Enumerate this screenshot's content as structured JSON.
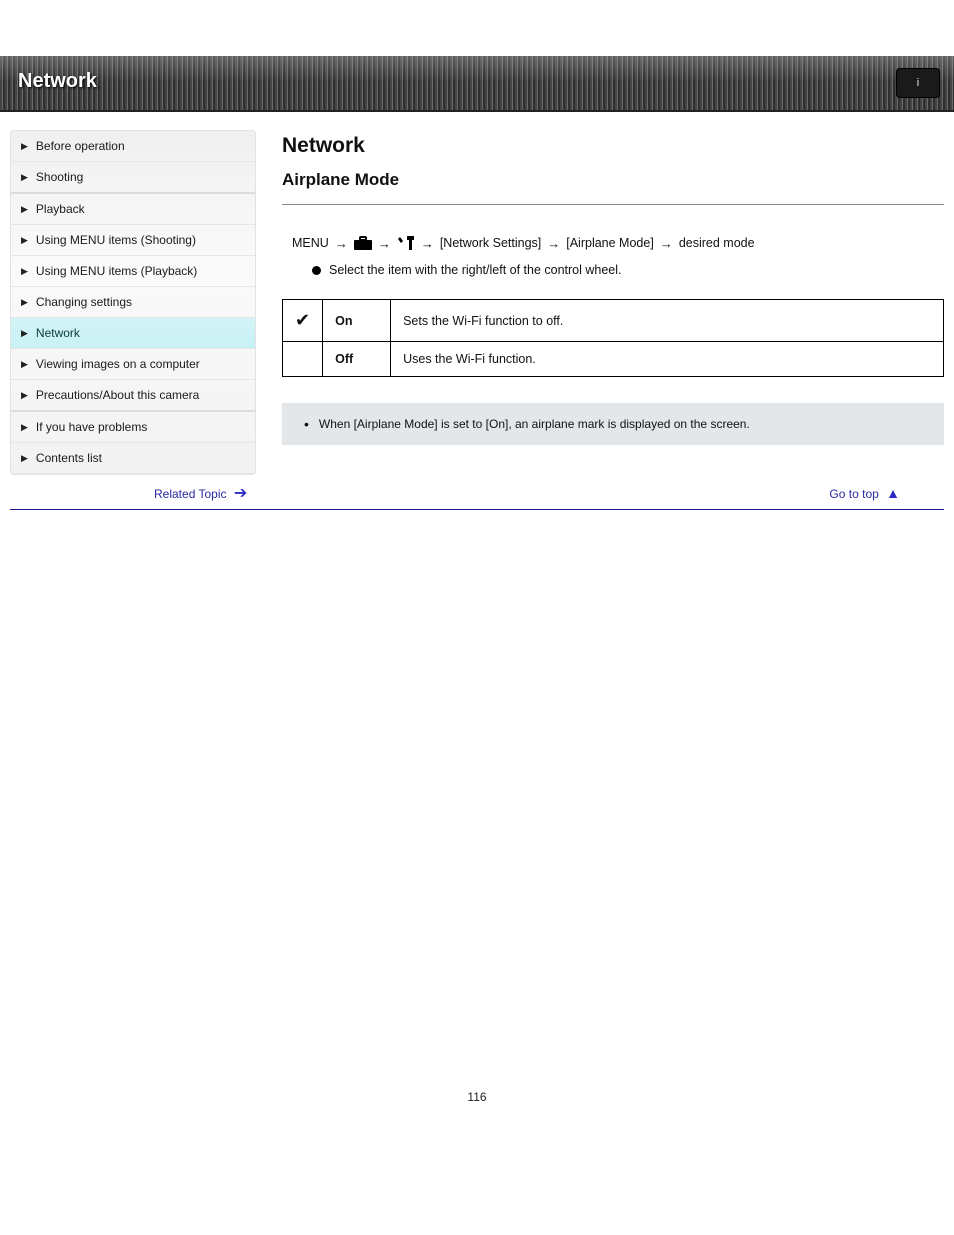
{
  "banner": {
    "title": "Network",
    "button_label": "i"
  },
  "sidebar": {
    "items": [
      {
        "label": "Before operation"
      },
      {
        "label": "Shooting"
      },
      {
        "label": "Playback"
      },
      {
        "label": "Using MENU items (Shooting)"
      },
      {
        "label": "Using MENU items (Playback)"
      },
      {
        "label": "Changing settings"
      },
      {
        "label": "Network"
      },
      {
        "label": "Viewing images on a computer"
      },
      {
        "label": "Precautions/About this camera"
      },
      {
        "label": "If you have problems"
      },
      {
        "label": "Contents list"
      }
    ]
  },
  "content": {
    "heading1": "Network",
    "heading2": "Airplane Mode",
    "navpath": {
      "step_menu": "MENU",
      "step_toolbox": "",
      "step_tools": "",
      "step_network": "[Network Settings]",
      "step_airplane": "[Airplane Mode]",
      "step_desired": "desired mode"
    },
    "substep": "Select the item with the right/left of the control wheel.",
    "table": [
      {
        "icon": "check",
        "option": "On",
        "desc": "Sets the Wi-Fi function to off."
      },
      {
        "icon": "",
        "option": "Off",
        "desc": "Uses the Wi-Fi function."
      }
    ],
    "note": "When [Airplane Mode] is set to [On], an airplane mark is displayed on the screen."
  },
  "bottomnav": {
    "related_label": "Related Topic",
    "gototop_label": "Go to top"
  },
  "page_number": "116"
}
